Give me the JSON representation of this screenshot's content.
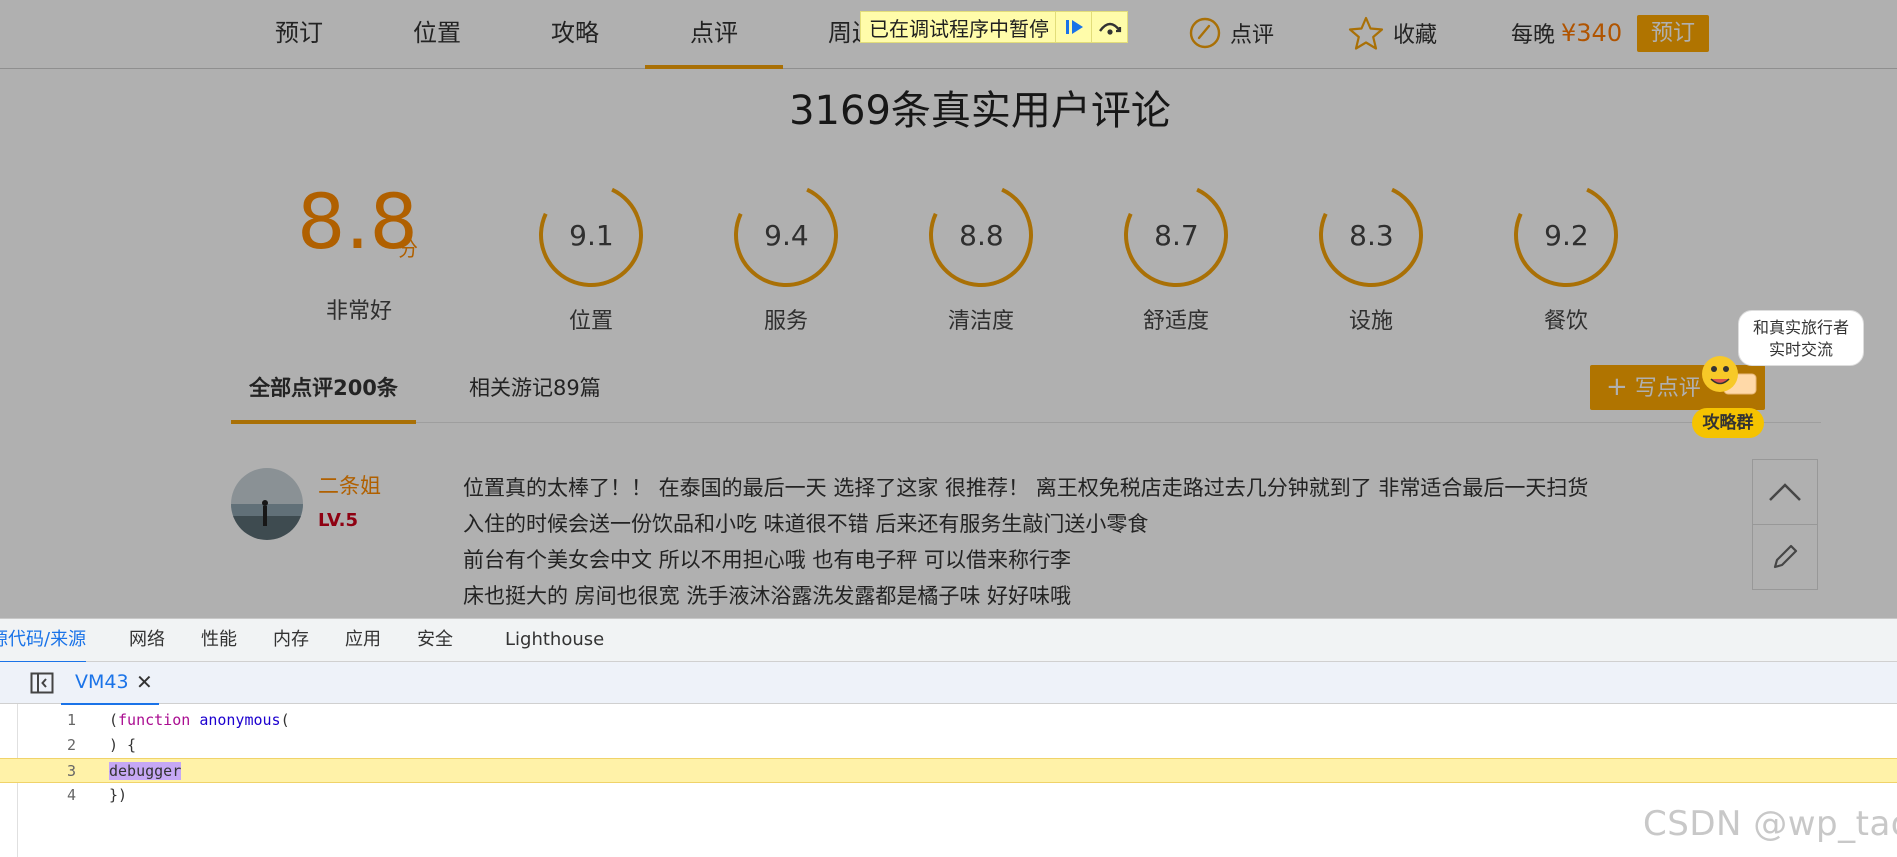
{
  "nav": {
    "items": [
      "预订",
      "位置",
      "攻略",
      "点评",
      "周边"
    ],
    "active_index": 3,
    "review_label": "点评",
    "favorite_label": "收藏",
    "price_label": "每晚",
    "price": "¥340",
    "book_label": "预订"
  },
  "debugger_banner": {
    "text": "已在调试程序中暂停",
    "resume_icon": "resume-icon",
    "step_over_icon": "step-over-icon"
  },
  "reviews": {
    "title": "3169条真实用户评论",
    "overall_score": "8.8",
    "overall_unit": "分",
    "overall_label": "非常好",
    "sub_scores": [
      {
        "value": "9.1",
        "label": "位置"
      },
      {
        "value": "9.4",
        "label": "服务"
      },
      {
        "value": "8.8",
        "label": "清洁度"
      },
      {
        "value": "8.7",
        "label": "舒适度"
      },
      {
        "value": "8.3",
        "label": "设施"
      },
      {
        "value": "9.2",
        "label": "餐饮"
      }
    ],
    "tabs": [
      "全部点评200条",
      "相关游记89篇"
    ],
    "active_tab": 0,
    "write_label": "写点评"
  },
  "chat_widget": {
    "bubble_line1": "和真实旅行者",
    "bubble_line2": "实时交流",
    "badge": "攻略群"
  },
  "first_review": {
    "username": "二条姐",
    "level": "LV.5",
    "lines": [
      "位置真的太棒了！！ 在泰国的最后一天 选择了这家 很推荐！ 离王权免税店走路过去几分钟就到了 非常适合最后一天扫货",
      "入住的时候会送一份饮品和小吃 味道很不错 后来还有服务生敲门送小零食",
      "前台有个美女会中文 所以不用担心哦 也有电子秤 可以借来称行李",
      "床也挺大的 房间也很宽 洗手液沐浴露洗发露都是橘子味 好好味哦"
    ]
  },
  "devtools": {
    "tabs": [
      "源代码/来源",
      "网络",
      "性能",
      "内存",
      "应用",
      "安全",
      "Lighthouse"
    ],
    "active_tab": 0,
    "file_name": "VM43",
    "close_glyph": "✕",
    "code_lines": [
      {
        "num": "1",
        "text": "(function anonymous("
      },
      {
        "num": "2",
        "text": ") {"
      },
      {
        "num": "3",
        "text": "debugger"
      },
      {
        "num": "4",
        "text": "})"
      }
    ],
    "paused_line": 3
  },
  "watermark": "CSDN @wp_tao",
  "colors": {
    "accent": "#f5a20a",
    "price": "#ff7a00",
    "button": "#ffa800",
    "level": "#d0021b",
    "devtools_blue": "#1a73e8",
    "paused_line": "#fff2a8"
  }
}
